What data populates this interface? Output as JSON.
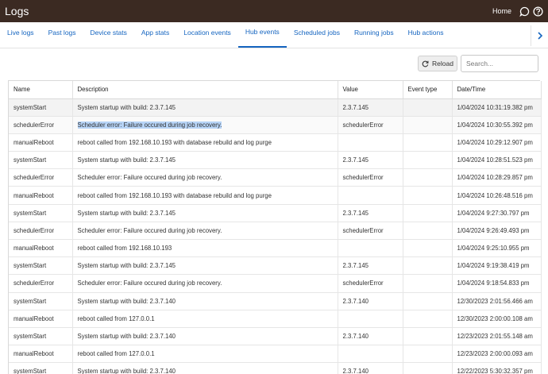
{
  "header": {
    "title": "Logs",
    "home_label": "Home",
    "icons": [
      "chat-icon",
      "help-icon"
    ]
  },
  "tabs": [
    {
      "label": "Live logs",
      "active": false
    },
    {
      "label": "Past logs",
      "active": false
    },
    {
      "label": "Device stats",
      "active": false
    },
    {
      "label": "App stats",
      "active": false
    },
    {
      "label": "Location events",
      "active": false
    },
    {
      "label": "Hub events",
      "active": true
    },
    {
      "label": "Scheduled jobs",
      "active": false
    },
    {
      "label": "Running jobs",
      "active": false
    },
    {
      "label": "Hub actions",
      "active": false
    }
  ],
  "toolbar": {
    "reload_label": "Reload",
    "search_placeholder": "Search..."
  },
  "table": {
    "columns": [
      "Name",
      "Description",
      "Value",
      "Event type",
      "Date/Time"
    ],
    "rows": [
      [
        "systemStart",
        "System startup with build: 2.3.7.145",
        "2.3.7.145",
        "",
        "1/04/2024 10:31:19.382 pm"
      ],
      [
        "schedulerError",
        "Scheduler error: Failure occured during job recovery.",
        "schedulerError",
        "",
        "1/04/2024 10:30:55.392 pm"
      ],
      [
        "manualReboot",
        "reboot called from 192.168.10.193 with database rebuild and log purge",
        "",
        "",
        "1/04/2024 10:29:12.907 pm"
      ],
      [
        "systemStart",
        "System startup with build: 2.3.7.145",
        "2.3.7.145",
        "",
        "1/04/2024 10:28:51.523 pm"
      ],
      [
        "schedulerError",
        "Scheduler error: Failure occured during job recovery.",
        "schedulerError",
        "",
        "1/04/2024 10:28:29.857 pm"
      ],
      [
        "manualReboot",
        "reboot called from 192.168.10.193 with database rebuild and log purge",
        "",
        "",
        "1/04/2024 10:26:48.516 pm"
      ],
      [
        "systemStart",
        "System startup with build: 2.3.7.145",
        "2.3.7.145",
        "",
        "1/04/2024 9:27:30.797 pm"
      ],
      [
        "schedulerError",
        "Scheduler error: Failure occured during job recovery.",
        "schedulerError",
        "",
        "1/04/2024 9:26:49.493 pm"
      ],
      [
        "manualReboot",
        "reboot called from 192.168.10.193",
        "",
        "",
        "1/04/2024 9:25:10.955 pm"
      ],
      [
        "systemStart",
        "System startup with build: 2.3.7.145",
        "2.3.7.145",
        "",
        "1/04/2024 9:19:38.419 pm"
      ],
      [
        "schedulerError",
        "Scheduler error: Failure occured during job recovery.",
        "schedulerError",
        "",
        "1/04/2024 9:18:54.833 pm"
      ],
      [
        "systemStart",
        "System startup with build: 2.3.7.140",
        "2.3.7.140",
        "",
        "12/30/2023 2:01:56.466 am"
      ],
      [
        "manualReboot",
        "reboot called from 127.0.0.1",
        "",
        "",
        "12/30/2023 2:00:00.108 am"
      ],
      [
        "systemStart",
        "System startup with build: 2.3.7.140",
        "2.3.7.140",
        "",
        "12/23/2023 2:01:55.148 am"
      ],
      [
        "manualReboot",
        "reboot called from 127.0.0.1",
        "",
        "",
        "12/23/2023 2:00:00.093 am"
      ],
      [
        "systemStart",
        "System startup with build: 2.3.7.140",
        "2.3.7.140",
        "",
        "12/22/2023 5:30:32.357 pm"
      ]
    ]
  },
  "colors": {
    "topbar": "#3b2a22",
    "tab_text": "#1565c0",
    "highlight": "#b7d4f7"
  }
}
